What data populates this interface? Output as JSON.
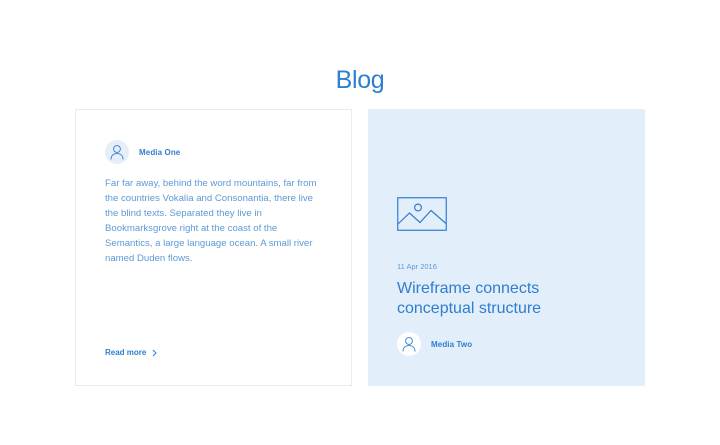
{
  "section": {
    "title": "Blog"
  },
  "cards": [
    {
      "author": "Media One",
      "excerpt": "Far far away, behind the word mountains, far from the countries Vokalia and Consonantia, there live the blind texts. Separated they live in Bookmarksgrove right at the coast of the Semantics, a large language ocean. A small river named Duden flows.",
      "link_label": "Read more",
      "link_icon": "chevron-right-icon",
      "avatar_icon": "user-icon"
    },
    {
      "image_icon": "image-placeholder-icon",
      "date": "11 Apr 2016",
      "title": "Wireframe connects conceptual structure",
      "author": "Media Two",
      "avatar_icon": "user-icon"
    }
  ],
  "colors": {
    "accent": "#2f7ecf",
    "text_muted": "#5c9ad6",
    "card_highlight_bg": "#e2eefa",
    "card_border": "#e4ecf4"
  }
}
